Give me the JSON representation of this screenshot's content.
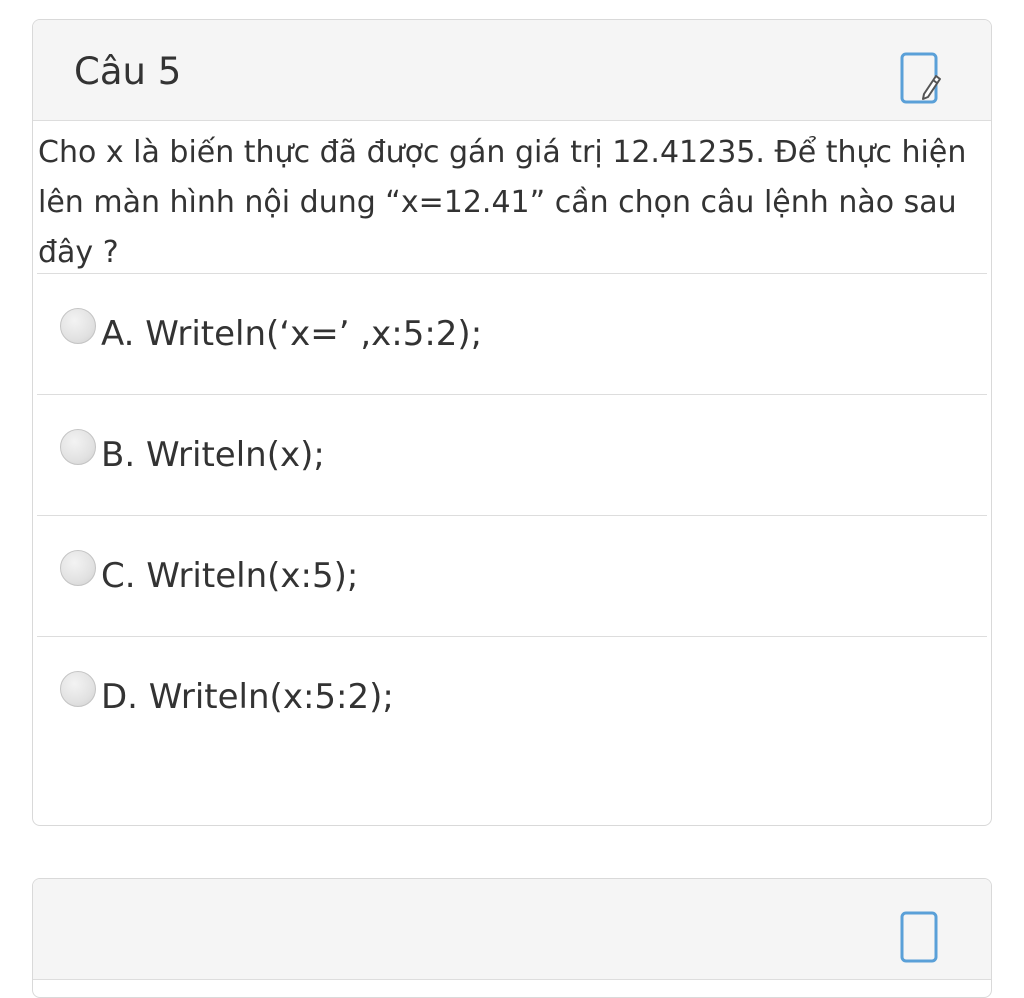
{
  "question_card": {
    "title": "Câu 5",
    "note_icon": "note-edit-icon",
    "question_text": "Cho x là biến thực đã được gán giá trị 12.41235. Để thực hiện lên màn hình nội dung “x=12.41” cần chọn câu lệnh nào sau đây ?",
    "options": [
      {
        "label": "A. Writeln(‘x=’ ,x:5:2);",
        "selected": false
      },
      {
        "label": "B. Writeln(x);",
        "selected": false
      },
      {
        "label": "C. Writeln(x:5);",
        "selected": false
      },
      {
        "label": "D. Writeln(x:5:2);",
        "selected": false
      }
    ]
  },
  "next_card": {
    "note_icon": "note-edit-icon"
  }
}
